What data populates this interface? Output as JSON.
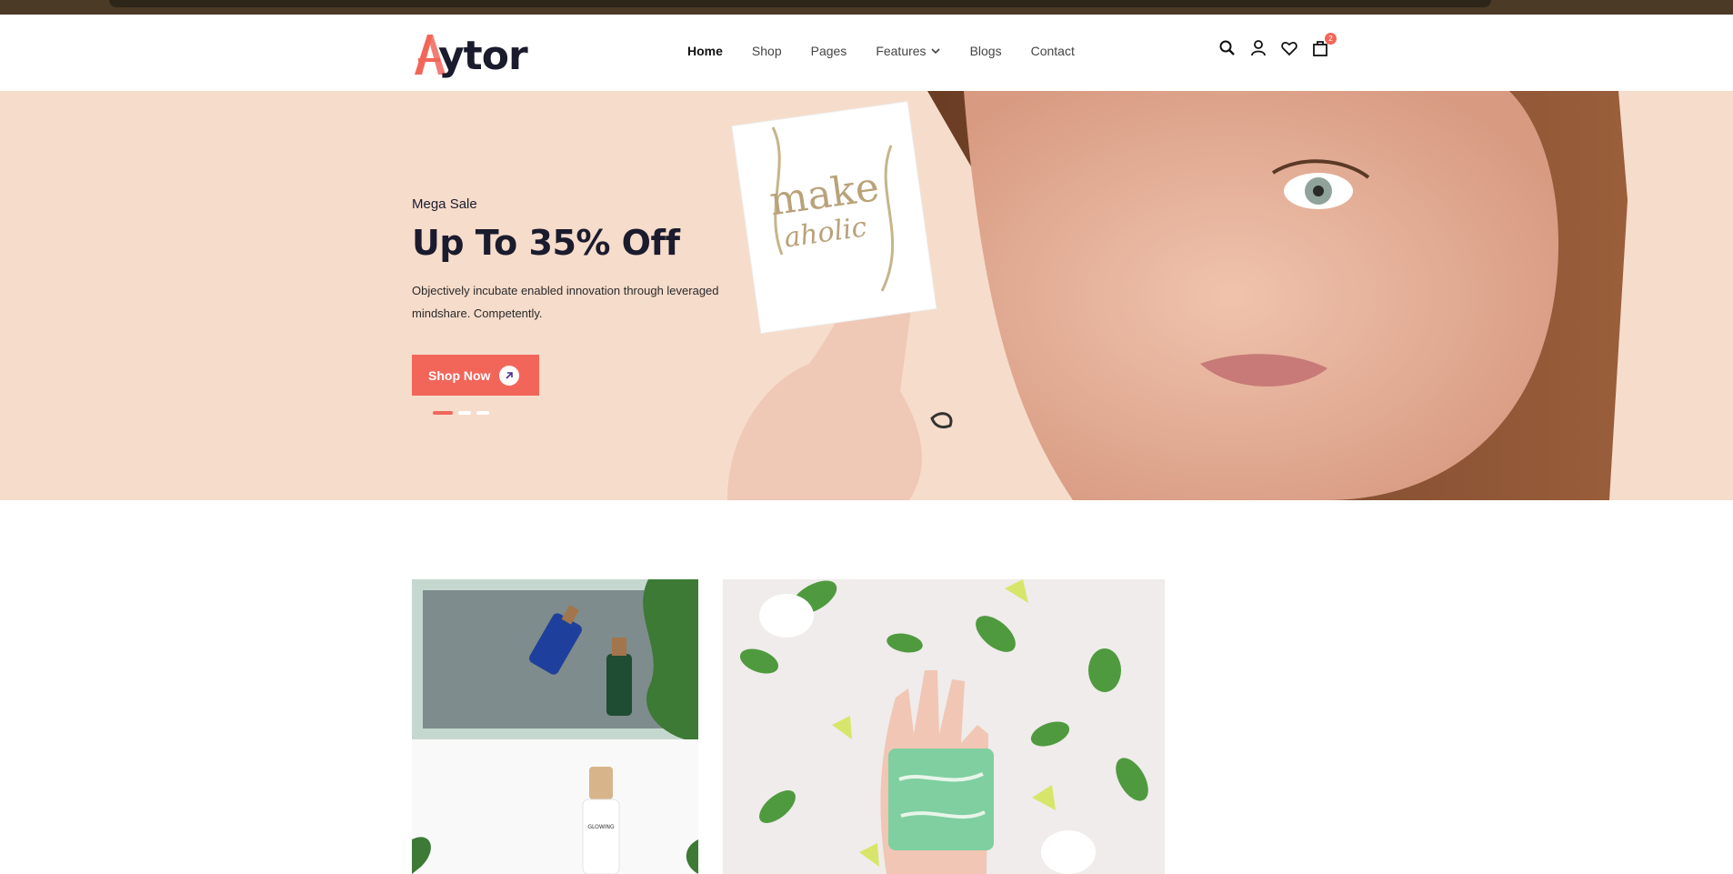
{
  "brand": {
    "logo_first_letter": "A",
    "logo_rest": "ytor",
    "accent_color": "#f2665a"
  },
  "nav": {
    "items": [
      {
        "label": "Home",
        "active": true
      },
      {
        "label": "Shop"
      },
      {
        "label": "Pages"
      },
      {
        "label": "Features",
        "has_dropdown": true
      },
      {
        "label": "Blogs"
      },
      {
        "label": "Contact"
      }
    ],
    "icons": [
      "search-icon",
      "user-icon",
      "heart-icon",
      "cart-icon"
    ],
    "cart_count": "2"
  },
  "hero": {
    "eyebrow": "Mega Sale",
    "headline": "Up To 35% Off",
    "description": "Objectively incubate enabled innovation through leveraged mindshare. Competently.",
    "button_label": "Shop Now",
    "slides": 3,
    "active_slide": 1,
    "card_text": "make aholic",
    "background_color": "#f6dccb"
  },
  "products": {
    "bottle_label": "GLOWING"
  }
}
